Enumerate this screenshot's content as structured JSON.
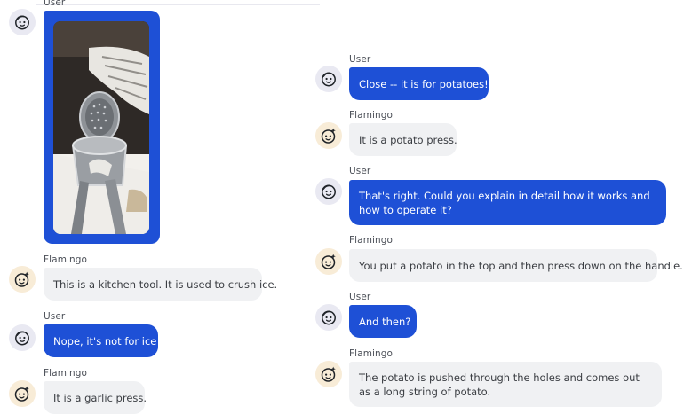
{
  "left_column": {
    "messages": [
      {
        "role": "user",
        "sender": "User",
        "type": "image",
        "image_description": "photo of a metal kitchen press tool on a counter"
      },
      {
        "role": "bot",
        "sender": "Flamingo",
        "text": "This is a kitchen tool. It is used to crush ice."
      },
      {
        "role": "user",
        "sender": "User",
        "text": "Nope, it's not for ice!"
      },
      {
        "role": "bot",
        "sender": "Flamingo",
        "text": "It is a garlic press."
      }
    ]
  },
  "right_column": {
    "messages": [
      {
        "role": "user",
        "sender": "User",
        "text": "Close -- it is for potatoes!"
      },
      {
        "role": "bot",
        "sender": "Flamingo",
        "text": "It is a potato press."
      },
      {
        "role": "user",
        "sender": "User",
        "text": "That's right. Could you explain in detail how it works and how to operate it?"
      },
      {
        "role": "bot",
        "sender": "Flamingo",
        "text": "You put a potato in the top and then press down on the handle."
      },
      {
        "role": "user",
        "sender": "User",
        "text": "And then?"
      },
      {
        "role": "bot",
        "sender": "Flamingo",
        "text": "The potato is pushed through the holes and comes out as a long string of potato."
      }
    ]
  },
  "icons": {
    "user_avatar": "user-face-icon",
    "bot_avatar": "flamingo-face-icon"
  },
  "colors": {
    "user_bubble": "#1e50d6",
    "bot_bubble": "#f0f1f3",
    "user_avatar_bg": "#e9e9f2",
    "bot_avatar_bg": "#f8ecd7"
  }
}
